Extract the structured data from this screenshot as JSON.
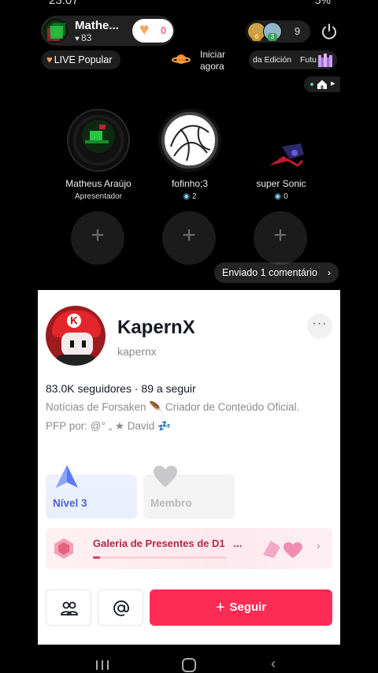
{
  "status_bar": {
    "time": "23:07",
    "battery": "5%"
  },
  "host": {
    "name": "Mathe...",
    "likes": "83",
    "like_count": "0"
  },
  "viewers": {
    "count": "9",
    "badge_1": "6",
    "badge_2": "3"
  },
  "top_row": {
    "live_popular": "LIVE Popular",
    "start_now": "Iniciar agora",
    "edition": "da Edición",
    "edition_extra": "Futu"
  },
  "guests": [
    {
      "name": "Matheus Araújo",
      "sub": "Apresentador"
    },
    {
      "name": "fofinho;3",
      "sub": "2"
    },
    {
      "name": "super Sonic",
      "sub": "0"
    }
  ],
  "add_slot_symbol": "+",
  "sent_comment": "Enviado 1 comentário",
  "profile": {
    "name": "KapernX",
    "handle": "kapernx",
    "stats": "83.0K seguidores · 89 a seguir",
    "bio_line_1": "Notícias de Forsaken 🪶 Criador de Conteúdo Oficial.",
    "bio_line_2": "PFP por: @° „ ★ David 💤",
    "more": "···",
    "level_label": "Nível 3",
    "member_label": "Membro",
    "gallery_title": "Galeria de Presentes de D1",
    "gallery_ellipsis": "...",
    "gallery_progress": 0.05,
    "follow_label": "Seguir",
    "follow_plus": "+"
  },
  "colors": {
    "follow_button": "#fe2c55",
    "level_text": "#4e62d9",
    "gallery_text": "#b7264a",
    "like_heart": "#f7a35c"
  },
  "icons": [
    "power-icon",
    "heart-icon",
    "planet-icon",
    "castle-icon",
    "home-icon",
    "arrow-level-icon",
    "heart-member-icon",
    "gem-icon",
    "friends-icon",
    "at-icon"
  ]
}
